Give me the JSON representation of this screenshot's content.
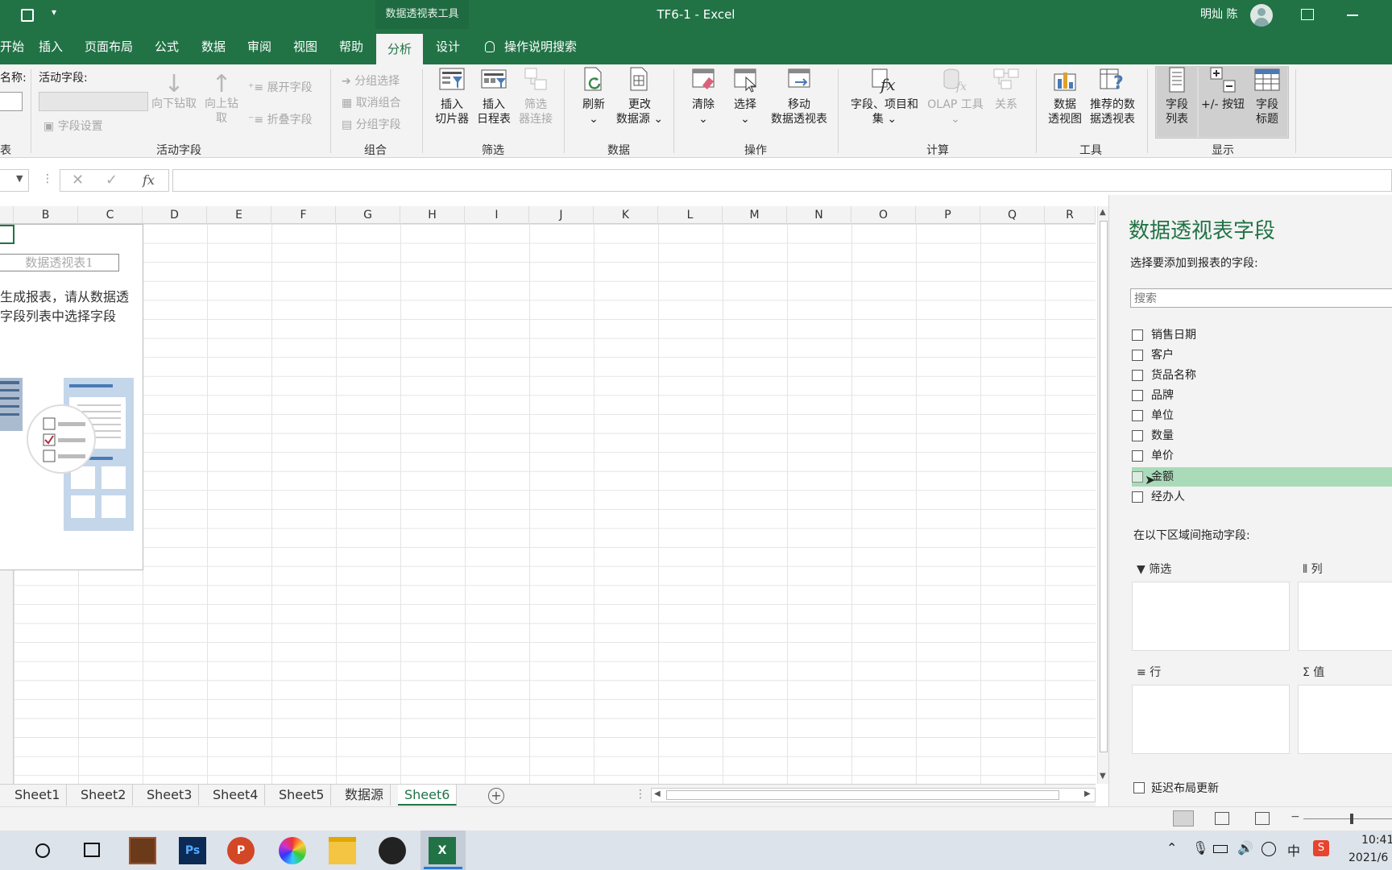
{
  "titlebar": {
    "context_tool": "数据透视表工具",
    "title": "TF6-1  -  Excel",
    "user": "明灿 陈"
  },
  "tabs": [
    "开始",
    "插入",
    "页面布局",
    "公式",
    "数据",
    "审阅",
    "视图",
    "帮助",
    "分析",
    "设计"
  ],
  "active_tab": "分析",
  "tell_me": "操作说明搜索",
  "ribbon": {
    "name_label": "名称:",
    "active_field_label": "活动字段:",
    "field_settings": "字段设置",
    "drill_down": "向下钻取",
    "drill_up": "向上钻取",
    "expand": "展开字段",
    "collapse": "折叠字段",
    "group_selection": "分组选择",
    "ungroup": "取消组合",
    "group_field": "分组字段",
    "insert_slicer": [
      "插入",
      "切片器"
    ],
    "insert_timeline": [
      "插入",
      "日程表"
    ],
    "filter_connections": [
      "筛选",
      "器连接"
    ],
    "refresh": "刷新",
    "change_source": [
      "更改",
      "数据源"
    ],
    "clear": "清除",
    "select": "选择",
    "move_pivot": [
      "移动",
      "数据透视表"
    ],
    "fields_items": [
      "字段、项目和",
      "集"
    ],
    "olap_tools": "OLAP 工具",
    "relationships": "关系",
    "pivot_chart": [
      "数据",
      "透视图"
    ],
    "recommended": [
      "推荐的数",
      "据透视表"
    ],
    "field_list": [
      "字段",
      "列表"
    ],
    "buttons": "+/- 按钮",
    "field_headers": [
      "字段",
      "标题"
    ],
    "groups": {
      "active_field": "活动字段",
      "group": "组合",
      "filter": "筛选",
      "data": "数据",
      "actions": "操作",
      "calculations": "计算",
      "tools": "工具",
      "show": "显示",
      "pivot": "表"
    }
  },
  "formula_bar": {
    "fx": "fx",
    "value": ""
  },
  "columns": [
    "B",
    "C",
    "D",
    "E",
    "F",
    "G",
    "H",
    "I",
    "J",
    "K",
    "L",
    "M",
    "N",
    "O",
    "P",
    "Q",
    "R"
  ],
  "pivot_placeholder": {
    "name": "数据透视表1",
    "hint_line1": "生成报表，请从数据透",
    "hint_line2": "字段列表中选择字段"
  },
  "sheets": [
    "Sheet1",
    "Sheet2",
    "Sheet3",
    "Sheet4",
    "Sheet5",
    "数据源",
    "Sheet6"
  ],
  "active_sheet": "Sheet6",
  "pane": {
    "title": "数据透视表字段",
    "subtitle": "选择要添加到报表的字段:",
    "search_placeholder": "搜索",
    "fields": [
      "销售日期",
      "客户",
      "货品名称",
      "品牌",
      "单位",
      "数量",
      "单价",
      "金额",
      "经办人"
    ],
    "highlighted_field": "金额",
    "drag_label": "在以下区域间拖动字段:",
    "areas": {
      "filter": "筛选",
      "columns": "列",
      "rows": "行",
      "values": "值"
    },
    "defer_update": "延迟布局更新"
  },
  "taskbar": {
    "time": "10:41",
    "date": "2021/6",
    "ime": "中"
  }
}
